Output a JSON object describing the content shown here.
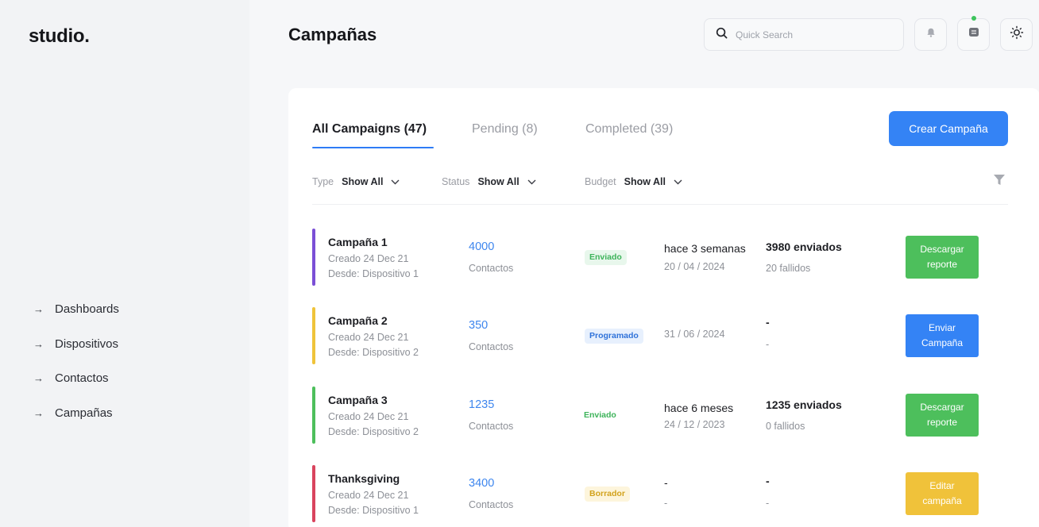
{
  "app": {
    "logo": "studio."
  },
  "sidebar": {
    "items": [
      {
        "label": "Dashboards"
      },
      {
        "label": "Dispositivos"
      },
      {
        "label": "Contactos"
      },
      {
        "label": "Campañas"
      }
    ],
    "arrow": "→"
  },
  "header": {
    "title": "Campañas",
    "search_placeholder": "Quick Search",
    "icons": [
      "search-icon",
      "bell-icon",
      "message-icon",
      "sun-icon"
    ]
  },
  "tabs": [
    {
      "label": "All Campaigns (47)",
      "active": true
    },
    {
      "label": "Pending (8)",
      "active": false
    },
    {
      "label": "Completed (39)",
      "active": false
    }
  ],
  "create_button": "Crear Campaña",
  "filters": [
    {
      "label": "Type",
      "value": "Show All"
    },
    {
      "label": "Status",
      "value": "Show All"
    },
    {
      "label": "Budget",
      "value": "Show All"
    }
  ],
  "campaigns": [
    {
      "name": "Campaña 1",
      "created": "Creado 24 Dec 21",
      "device": "Desde: Dispositivo 1",
      "contacts": "4000",
      "contacts_label": "Contactos",
      "status": "Enviado",
      "status_fg": "#3db35a",
      "status_bg": "#e8f7ec",
      "time": "hace 3 semanas",
      "date": "20 / 04 / 2024",
      "sent": "3980 enviados",
      "failed": "20 fallidos",
      "action": "Descargar reporte",
      "action_color": "#4dbf5c",
      "accent": "#7b4fd6"
    },
    {
      "name": "Campaña 2",
      "created": "Creado 24 Dec 21",
      "device": "Desde: Dispositivo 2",
      "contacts": "350",
      "contacts_label": "Contactos",
      "status": "Programado",
      "status_fg": "#2f72d9",
      "status_bg": "#e7f0fd",
      "time": "",
      "date": "31 / 06 / 2024",
      "sent": "-",
      "failed": "-",
      "action": "Enviar Campaña",
      "action_color": "#3483f5",
      "accent": "#efc33a"
    },
    {
      "name": "Campaña 3",
      "created": "Creado 24 Dec 21",
      "device": "Desde: Dispositivo 2",
      "contacts": "1235",
      "contacts_label": "Contactos",
      "status": "Enviado",
      "status_fg": "#3db35a",
      "status_bg": "#ffffff",
      "time": "hace 6 meses",
      "date": "24 / 12 / 2023",
      "sent": "1235 enviados",
      "failed": "0 fallidos",
      "action": "Descargar reporte",
      "action_color": "#4dbf5c",
      "accent": "#4dbf5c"
    },
    {
      "name": "Thanksgiving",
      "created": "Creado 24 Dec 21",
      "device": "Desde: Dispositivo 1",
      "contacts": "3400",
      "contacts_label": "Contactos",
      "status": "Borrador",
      "status_fg": "#d2a21c",
      "status_bg": "#fdf5dc",
      "time": "-",
      "date": "-",
      "sent": "-",
      "failed": "-",
      "action": "Editar campaña",
      "action_color": "#f0c23a",
      "accent": "#d9445e"
    }
  ]
}
